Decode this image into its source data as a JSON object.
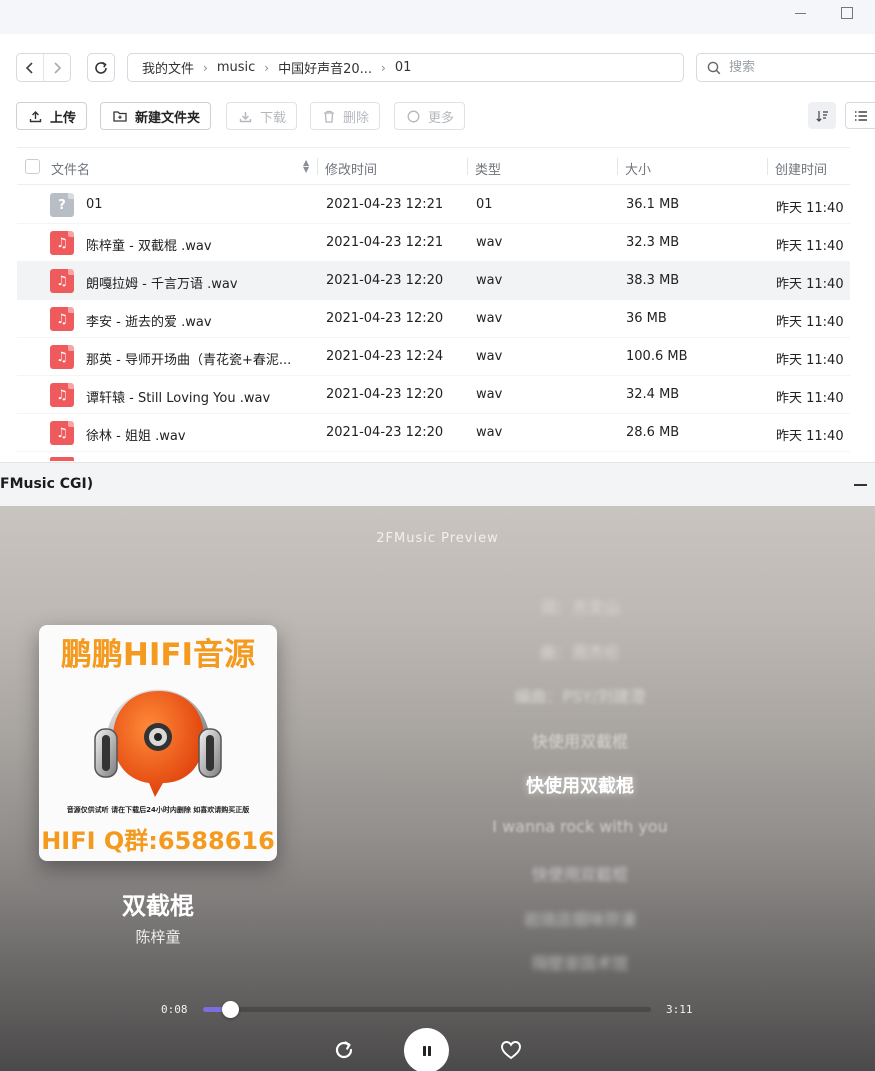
{
  "window": {
    "minimize_label": "",
    "maximize_label": ""
  },
  "breadcrumb": [
    "我的文件",
    "music",
    "中国好声音20...",
    "01"
  ],
  "search": {
    "placeholder": "搜索"
  },
  "actions": {
    "upload": "上传",
    "new_folder": "新建文件夹",
    "download": "下载",
    "delete": "删除",
    "more": "更多"
  },
  "table": {
    "headers": {
      "name": "文件名",
      "modified": "修改时间",
      "type": "类型",
      "size": "大小",
      "created": "创建时间"
    },
    "rows": [
      {
        "name": "01",
        "modified": "2021-04-23 12:21",
        "type": "01",
        "size": "36.1 MB",
        "created": "昨天 11:40",
        "icon": "unknown-file-icon"
      },
      {
        "name": "陈梓童 - 双截棍 .wav",
        "modified": "2021-04-23 12:21",
        "type": "wav",
        "size": "32.3 MB",
        "created": "昨天 11:40",
        "icon": "music-file-icon"
      },
      {
        "name": "朗嘎拉姆 - 千言万语 .wav",
        "modified": "2021-04-23 12:20",
        "type": "wav",
        "size": "38.3 MB",
        "created": "昨天 11:40",
        "icon": "music-file-icon"
      },
      {
        "name": "李安 - 逝去的爱 .wav",
        "modified": "2021-04-23 12:20",
        "type": "wav",
        "size": "36 MB",
        "created": "昨天 11:40",
        "icon": "music-file-icon"
      },
      {
        "name": "那英 - 导师开场曲（青花瓷+春泥...",
        "modified": "2021-04-23 12:24",
        "type": "wav",
        "size": "100.6 MB",
        "created": "昨天 11:40",
        "icon": "music-file-icon"
      },
      {
        "name": "谭轩辕 - Still Loving You .wav",
        "modified": "2021-04-23 12:20",
        "type": "wav",
        "size": "32.4 MB",
        "created": "昨天 11:40",
        "icon": "music-file-icon"
      },
      {
        "name": "徐林 - 姐姐 .wav",
        "modified": "2021-04-23 12:20",
        "type": "wav",
        "size": "28.6 MB",
        "created": "昨天 11:40",
        "icon": "music-file-icon"
      }
    ],
    "highlight_row": 2
  },
  "panel": {
    "title": "FMusic CGI)"
  },
  "player": {
    "title": "2FMusic Preview",
    "album": {
      "top_text": "鹏鹏HIFI音源",
      "note": "音源仅供试听 请在下载后24小时内删除 如喜欢请购买正版",
      "bottom_text": "HIFI Q群:6588616"
    },
    "song": "双截棍",
    "artist": "陈梓童",
    "lyrics": [
      {
        "text": "词：方文山",
        "level": 3
      },
      {
        "text": "曲：周杰伦",
        "level": 3
      },
      {
        "text": "编曲：PSY/刘建澄",
        "level": 2
      },
      {
        "text": "快使用双截棍",
        "level": 1
      },
      {
        "text": "快使用双截棍",
        "level": 0
      },
      {
        "text": "I wanna rock with you",
        "level": 1
      },
      {
        "text": "快使用双截棍",
        "level": 2
      },
      {
        "text": "岩烧店烟味弥漫",
        "level": 3
      },
      {
        "text": "隔壁是国术馆",
        "level": 3
      }
    ],
    "current_time": "0:08",
    "total_time": "3:11",
    "progress": 0.06,
    "accent_color": "#7b6fe0"
  }
}
